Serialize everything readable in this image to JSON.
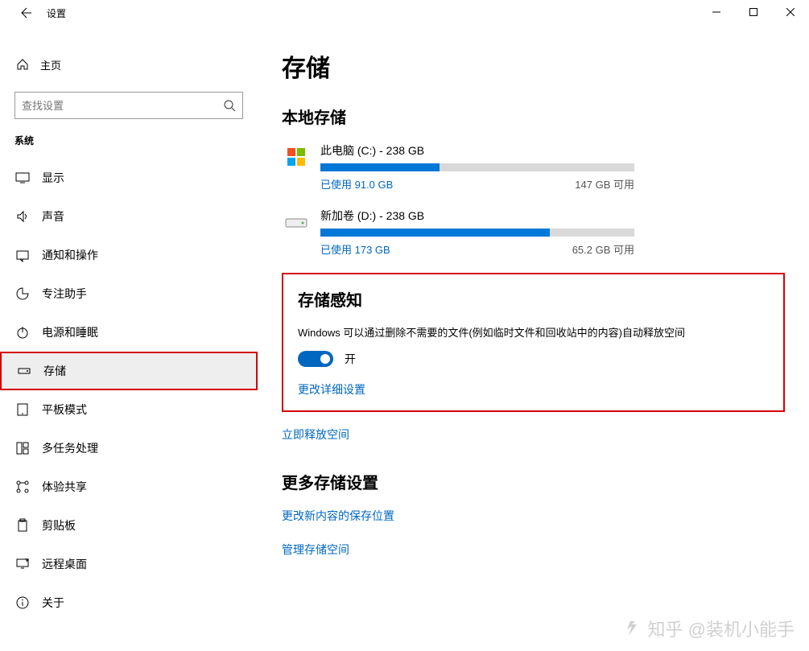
{
  "window": {
    "title": "设置"
  },
  "sidebar": {
    "home_label": "主页",
    "search_placeholder": "查找设置",
    "category_label": "系统",
    "items": [
      {
        "label": "显示"
      },
      {
        "label": "声音"
      },
      {
        "label": "通知和操作"
      },
      {
        "label": "专注助手"
      },
      {
        "label": "电源和睡眠"
      },
      {
        "label": "存储"
      },
      {
        "label": "平板模式"
      },
      {
        "label": "多任务处理"
      },
      {
        "label": "体验共享"
      },
      {
        "label": "剪贴板"
      },
      {
        "label": "远程桌面"
      },
      {
        "label": "关于"
      }
    ]
  },
  "page": {
    "title": "存储",
    "local_storage_title": "本地存储",
    "disks": [
      {
        "name": "此电脑 (C:) - 238 GB",
        "used": "已使用 91.0 GB",
        "available": "147 GB 可用",
        "percent": 38
      },
      {
        "name": "新加卷 (D:) - 238 GB",
        "used": "已使用 173 GB",
        "available": "65.2 GB 可用",
        "percent": 73
      }
    ],
    "sense_title": "存储感知",
    "sense_desc": "Windows 可以通过删除不需要的文件(例如临时文件和回收站中的内容)自动释放空间",
    "toggle_state_label": "开",
    "link_change_settings": "更改详细设置",
    "link_free_now": "立即释放空间",
    "more_title": "更多存储设置",
    "link_save_location": "更改新内容的保存位置",
    "link_manage_space": "管理存储空间"
  },
  "watermark": "知乎 @装机小能手"
}
